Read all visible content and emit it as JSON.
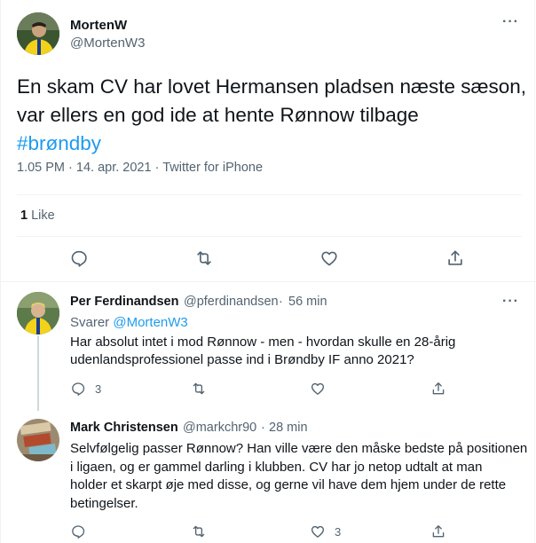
{
  "main_tweet": {
    "author_name": "MortenW",
    "author_handle": "@MortenW3",
    "text_line1": "En skam CV har lovet Hermansen pladsen næste sæson,",
    "text_line2": "var ellers en god ide at hente Rønnow tilbage",
    "hashtag": "#brøndby",
    "time": "1.05 PM",
    "date": "14. apr. 2021",
    "source": "Twitter for iPhone",
    "like_count": "1",
    "like_label": "Like",
    "more_label": "···"
  },
  "replies": [
    {
      "author_name": "Per Ferdinandsen",
      "author_handle": "@pferdinandsen",
      "age": "56 min",
      "replying_prefix": "Svarer",
      "replying_to": "@MortenW3",
      "text_line1": "Har absolut intet i mod Rønnow - men - hvordan skulle en 28-årig",
      "text_line2": "udenlandsprofessionel passe ind i Brøndby IF anno 2021?",
      "reply_count": "3",
      "more_label": "···"
    },
    {
      "author_name": "Mark Christensen",
      "author_handle": "@markchr90",
      "age": "28 min",
      "text_line1": "Selvfølgelig passer Rønnow? Han ville være den måske bedste på positionen",
      "text_line2": "i ligaen, og er gammel darling i klubben. CV har jo netop udtalt at man",
      "text_line3": "holder et skarpt øje med disse, og gerne vil have dem hjem under de rette",
      "text_line4": "betingelser.",
      "like_count": "3",
      "more_label": "···"
    }
  ],
  "colors": {
    "link": "#1d9bf0",
    "secondary_text": "#536471",
    "primary_text": "#0f1419",
    "border": "#eff3f4"
  },
  "icons": [
    "reply-icon",
    "retweet-icon",
    "like-icon",
    "share-icon",
    "more-icon"
  ]
}
